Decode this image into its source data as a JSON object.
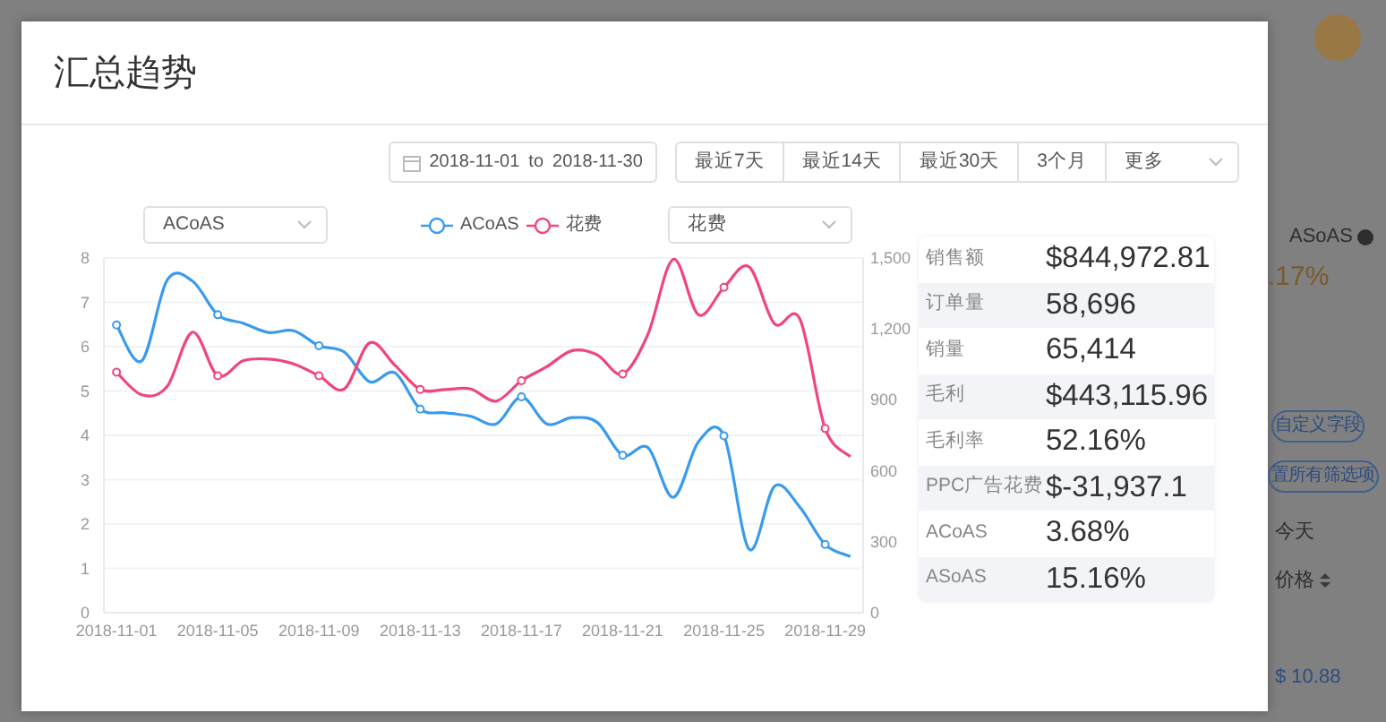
{
  "modal": {
    "title": "汇总趋势",
    "date_range": {
      "start": "2018-11-01",
      "separator": "to",
      "end": "2018-11-30"
    },
    "quick_ranges": [
      {
        "label": "最近7天",
        "selected": false
      },
      {
        "label": "最近14天",
        "selected": false
      },
      {
        "label": "最近30天",
        "selected": false
      },
      {
        "label": "3个月",
        "selected": false
      }
    ],
    "more_select": {
      "value": "更多"
    },
    "left_select": {
      "value": "ACoAS"
    },
    "right_select": {
      "value": "花费"
    },
    "chart_data": {
      "type": "line",
      "categories": [
        "2018-11-01",
        null,
        null,
        null,
        "2018-11-05",
        null,
        null,
        null,
        "2018-11-09",
        null,
        null,
        null,
        "2018-11-13",
        null,
        null,
        null,
        "2018-11-17",
        null,
        null,
        null,
        "2018-11-21",
        null,
        null,
        null,
        "2018-11-25",
        null,
        null,
        null,
        "2018-11-29",
        null
      ],
      "grid": true,
      "ylim": [
        0,
        8
      ],
      "yticks": [
        0,
        1,
        2,
        3,
        4,
        5,
        6,
        7,
        8
      ],
      "y2lim": [
        0,
        1500
      ],
      "y2ticks": [
        {
          "value": 0,
          "label": "0"
        },
        {
          "value": 300,
          "label": "300"
        },
        {
          "value": 600,
          "label": "600"
        },
        {
          "value": 900,
          "label": "900"
        },
        {
          "value": 1200,
          "label": "1,200"
        },
        {
          "value": 1500,
          "label": "1,500"
        }
      ],
      "series": [
        {
          "name": "ACoAS",
          "color": "#3a9bec",
          "values": [
            6.49,
            5.68,
            7.5,
            7.48,
            6.72,
            6.53,
            6.32,
            6.36,
            6.02,
            5.88,
            5.21,
            5.41,
            4.59,
            4.51,
            4.43,
            4.26,
            4.87,
            4.26,
            4.4,
            4.29,
            3.55,
            3.72,
            2.6,
            3.86,
            3.99,
            1.43,
            2.85,
            2.38,
            1.54,
            1.27
          ]
        },
        {
          "name": "花费",
          "color": "#ef467c",
          "axis": "y2",
          "values": [
            1017,
            921,
            956,
            1186,
            1002,
            1065,
            1073,
            1052,
            1002,
            946,
            1141,
            1047,
            944,
            944,
            946,
            895,
            981,
            1040,
            1108,
            1090,
            1009,
            1179,
            1495,
            1260,
            1376,
            1462,
            1222,
            1242,
            779,
            660
          ]
        }
      ]
    },
    "stats": [
      {
        "label": "销售额",
        "value": "$844,972.81"
      },
      {
        "label": "订单量",
        "value": "58,696"
      },
      {
        "label": "销量",
        "value": "65,414"
      },
      {
        "label": "毛利",
        "value": "$443,115.96"
      },
      {
        "label": "毛利率",
        "value": "52.16%"
      },
      {
        "label": "PPC广告花费",
        "value": "$-31,937.1"
      },
      {
        "label": "ACoAS",
        "value": "3.68%"
      },
      {
        "label": "ASoAS",
        "value": "15.16%"
      }
    ]
  },
  "background": {
    "metric_label": "ASoAS",
    "metric_value": ".17%",
    "custom_fields_button": "自定义字段",
    "reset_filters_button": "置所有筛选项",
    "column_group": "今天",
    "column_header": "价格",
    "price": "$ 10.88"
  }
}
